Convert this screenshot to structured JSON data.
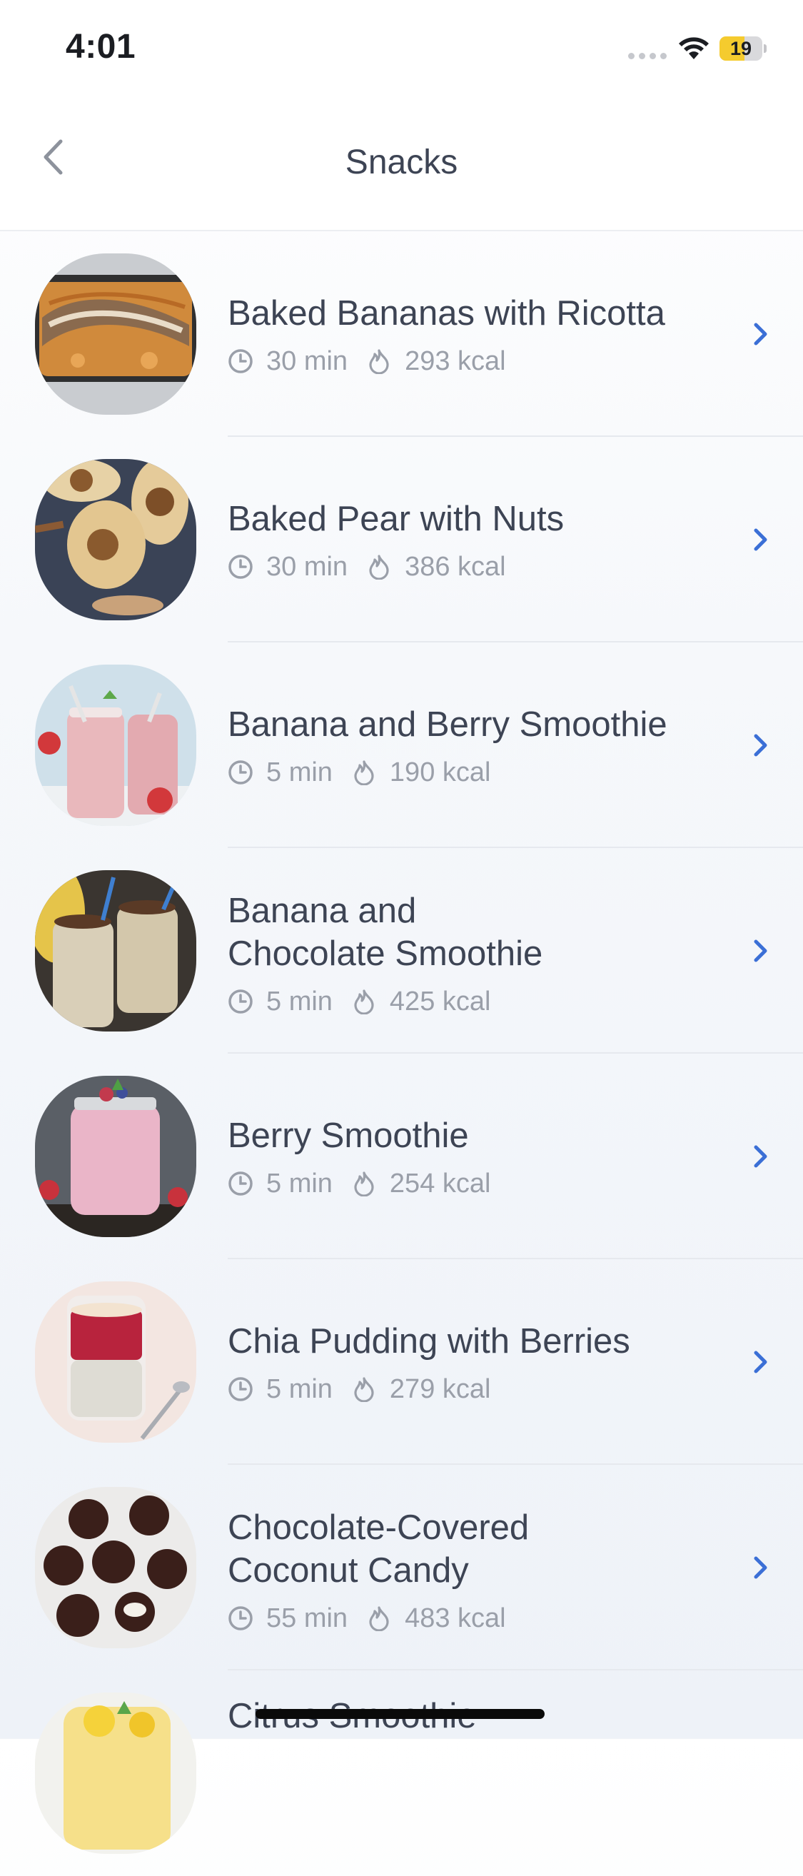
{
  "status_bar": {
    "time": "4:01",
    "battery_level": "19",
    "battery_fraction": 0.19
  },
  "nav": {
    "title": "Snacks",
    "back_icon": "chevron-left-icon"
  },
  "colors": {
    "accent": "#3b6fd6",
    "text": "#3d4454",
    "muted": "#9a9fa9"
  },
  "recipes": [
    {
      "title": "Baked Bananas with Ricotta",
      "time": "30 min",
      "kcal": "293 kcal"
    },
    {
      "title": "Baked Pear with Nuts",
      "time": "30 min",
      "kcal": "386 kcal"
    },
    {
      "title": "Banana and Berry Smoothie",
      "time": "5 min",
      "kcal": "190 kcal"
    },
    {
      "title": "Banana and\nChocolate Smoothie",
      "time": "5 min",
      "kcal": "425 kcal"
    },
    {
      "title": "Berry Smoothie",
      "time": "5 min",
      "kcal": "254 kcal"
    },
    {
      "title": "Chia Pudding with Berries",
      "time": "5 min",
      "kcal": "279 kcal"
    },
    {
      "title": "Chocolate-Covered\nCoconut Candy",
      "time": "55 min",
      "kcal": "483 kcal"
    },
    {
      "title": "Citrus Smoothie",
      "time": "",
      "kcal": ""
    }
  ]
}
